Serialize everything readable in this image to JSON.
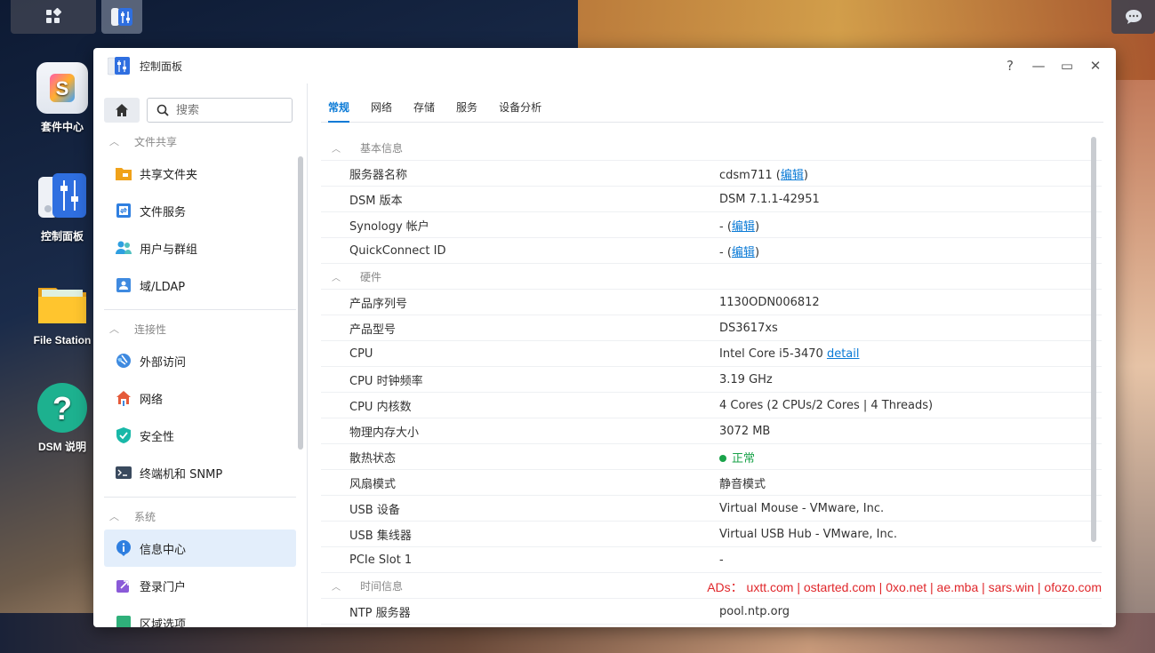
{
  "desktop": {
    "icons": [
      {
        "label": "套件中心"
      },
      {
        "label": "控制面板"
      },
      {
        "label": "File Station"
      },
      {
        "label": "DSM 说明"
      }
    ]
  },
  "window": {
    "title": "控制面板",
    "controls": {
      "help": "?",
      "minimize": "—",
      "maximize": "▭",
      "close": "✕"
    }
  },
  "sidebar": {
    "search_placeholder": "搜索",
    "sections": [
      {
        "title": "文件共享",
        "items": [
          "共享文件夹",
          "文件服务",
          "用户与群组",
          "域/LDAP"
        ]
      },
      {
        "title": "连接性",
        "items": [
          "外部访问",
          "网络",
          "安全性",
          "终端机和 SNMP"
        ]
      },
      {
        "title": "系统",
        "items": [
          "信息中心",
          "登录门户",
          "区域选项"
        ]
      }
    ]
  },
  "tabs": [
    "常规",
    "网络",
    "存储",
    "服务",
    "设备分析"
  ],
  "grid": {
    "basic": {
      "title": "基本信息",
      "rows": [
        {
          "k": "服务器名称",
          "v": "cdsm711",
          "edit": "编辑"
        },
        {
          "k": "DSM 版本",
          "v": "DSM 7.1.1-42951"
        },
        {
          "k": "Synology 帐户",
          "v": "-",
          "edit": "编辑"
        },
        {
          "k": "QuickConnect ID",
          "v": "-",
          "edit": "编辑"
        }
      ]
    },
    "hardware": {
      "title": "硬件",
      "rows": [
        {
          "k": "产品序列号",
          "v": "1130ODN006812"
        },
        {
          "k": "产品型号",
          "v": "DS3617xs"
        },
        {
          "k": "CPU",
          "v": "Intel Core i5-3470",
          "link": "detail"
        },
        {
          "k": "CPU 时钟频率",
          "v": "3.19 GHz"
        },
        {
          "k": "CPU 内核数",
          "v": "4 Cores (2 CPUs/2 Cores | 4 Threads)"
        },
        {
          "k": "物理内存大小",
          "v": "3072 MB"
        },
        {
          "k": "散热状态",
          "v": "正常"
        },
        {
          "k": "风扇模式",
          "v": "静音模式"
        },
        {
          "k": "USB 设备",
          "v": "Virtual Mouse - VMware, Inc."
        },
        {
          "k": "USB 集线器",
          "v": "Virtual USB Hub - VMware, Inc."
        },
        {
          "k": "PCIe Slot 1",
          "v": "-"
        }
      ]
    },
    "time": {
      "title": "时间信息",
      "ads": "ADs： uxtt.com | ostarted.com | 0xo.net | ae.mba | sars.win | ofozo.com",
      "rows": [
        {
          "k": "NTP 服务器",
          "v": "pool.ntp.org"
        }
      ]
    }
  },
  "colors": {
    "accent": "#0a7ad6",
    "ok": "#1aa34a",
    "ads": "#e0262a"
  }
}
